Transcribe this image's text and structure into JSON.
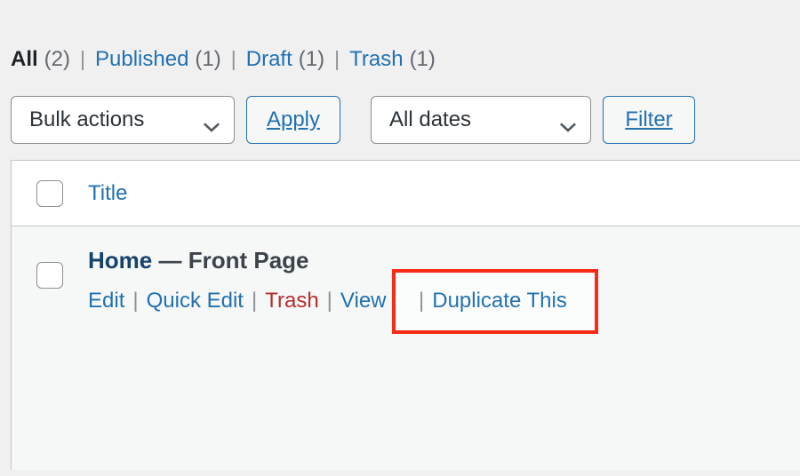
{
  "status_links": {
    "items": [
      {
        "label": "All",
        "count": "(2)",
        "current": true
      },
      {
        "label": "Published",
        "count": "(1)",
        "current": false
      },
      {
        "label": "Draft",
        "count": "(1)",
        "current": false
      },
      {
        "label": "Trash",
        "count": "(1)",
        "current": false
      }
    ],
    "separator": "|"
  },
  "toolbar": {
    "bulk_actions_value": "Bulk actions",
    "apply_label": "Apply",
    "all_dates_value": "All dates",
    "filter_label": "Filter"
  },
  "table": {
    "column_title": "Title",
    "row": {
      "title": "Home",
      "post_state": "— Front Page",
      "actions": {
        "edit": "Edit",
        "quick_edit": "Quick Edit",
        "trash": "Trash",
        "view": "View",
        "duplicate": "Duplicate This",
        "separator": "|"
      }
    }
  },
  "annotation": {
    "highlight_color": "#f82c15",
    "highlighted_text": "Duplicate This",
    "leading_separator": "|"
  }
}
